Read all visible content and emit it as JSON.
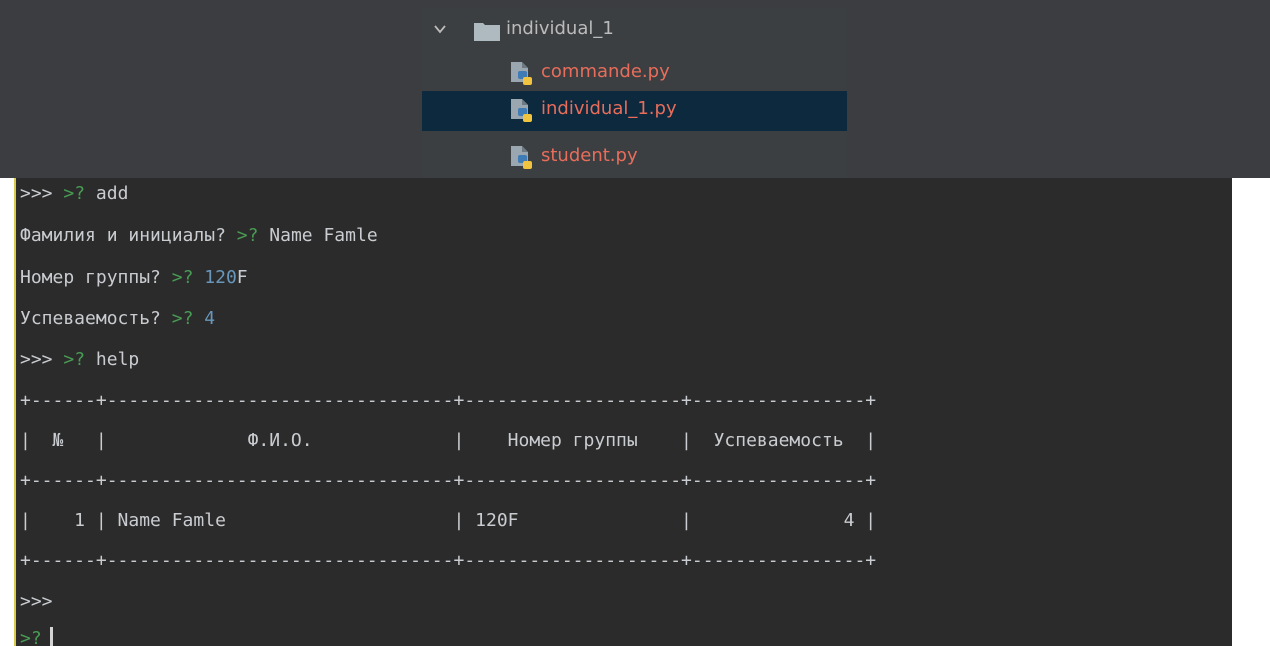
{
  "project_tree": {
    "folder": {
      "label": "individual_1",
      "chevron_icon": "chevron-down-icon",
      "folder_icon": "folder-icon"
    },
    "files": [
      {
        "label": "commande.py",
        "icon": "python-file-icon",
        "selected": false
      },
      {
        "label": "individual_1.py",
        "icon": "python-file-icon",
        "selected": true
      },
      {
        "label": "student.py",
        "icon": "python-file-icon",
        "selected": false
      }
    ],
    "colors": {
      "background": "#3c3f41",
      "selection": "#0d293e",
      "modified_file": "#e86d5b"
    }
  },
  "console": {
    "colors": {
      "background": "#2b2b2b",
      "text": "#c9ccd0",
      "input_prompt": "#499c54",
      "number": "#6897bb"
    },
    "main_prompt": ">>>",
    "input_prompt": ">?",
    "commands": {
      "add": "add",
      "help": "help"
    },
    "questions": {
      "name": "Фамилия и инициалы?",
      "group": "Номер группы?",
      "grade": "Успеваемость?"
    },
    "answers": {
      "name": "Name Famle",
      "group_number": "120",
      "group_letter": "F",
      "grade": "4"
    },
    "table": {
      "border_line": "+------+--------------------------------+--------------------+----------------+",
      "header_line": "|  №   |             Ф.И.О.             |    Номер группы    |  Успеваемость  |",
      "rows": [
        "|    1 | Name Famle                     | 120F               |              4 |"
      ]
    }
  }
}
